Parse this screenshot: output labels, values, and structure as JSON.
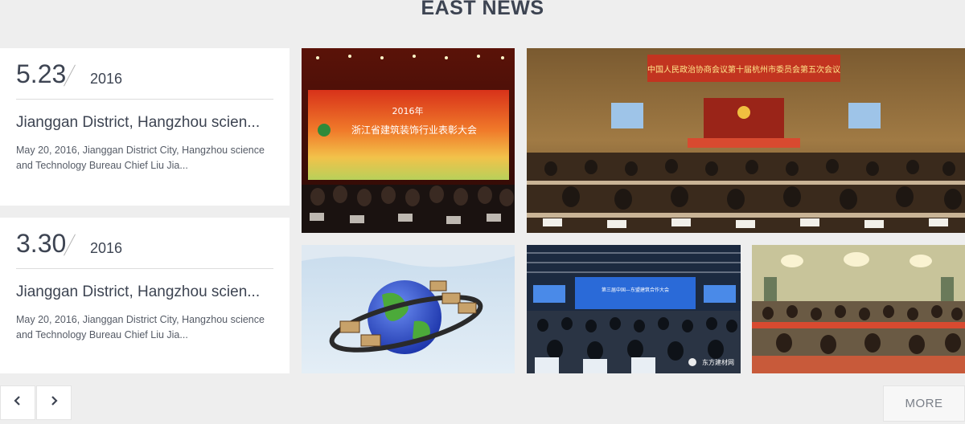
{
  "section": {
    "title": "EAST NEWS"
  },
  "news": [
    {
      "day": "5.23",
      "year": "2016",
      "title": "Jianggan District, Hangzhou scien...",
      "summary": "May 20, 2016, Jianggan District City, Hangzhou science and Technology Bureau Chief Liu Jia..."
    },
    {
      "day": "3.30",
      "year": "2016",
      "title": "Jianggan District, Hangzhou scien...",
      "summary": "May 20, 2016, Jianggan District City, Hangzhou science and Technology Bureau Chief Liu Jia..."
    }
  ],
  "photos": {
    "banner_year": "2016年",
    "banner_text": "浙江省建筑装饰行业表彰大会",
    "hall_banner": "中国人民政治协商会议第十届杭州市委员会第五次会议",
    "forum_banner": "第三届中国—东盟建筑合作大会",
    "watermark": "东方建材网"
  },
  "controls": {
    "prev_icon": "‹",
    "next_icon": "›",
    "more_label": "MORE"
  },
  "colors": {
    "background": "#eeeeee",
    "title_text": "#3d4452",
    "card_bg": "#ffffff"
  }
}
